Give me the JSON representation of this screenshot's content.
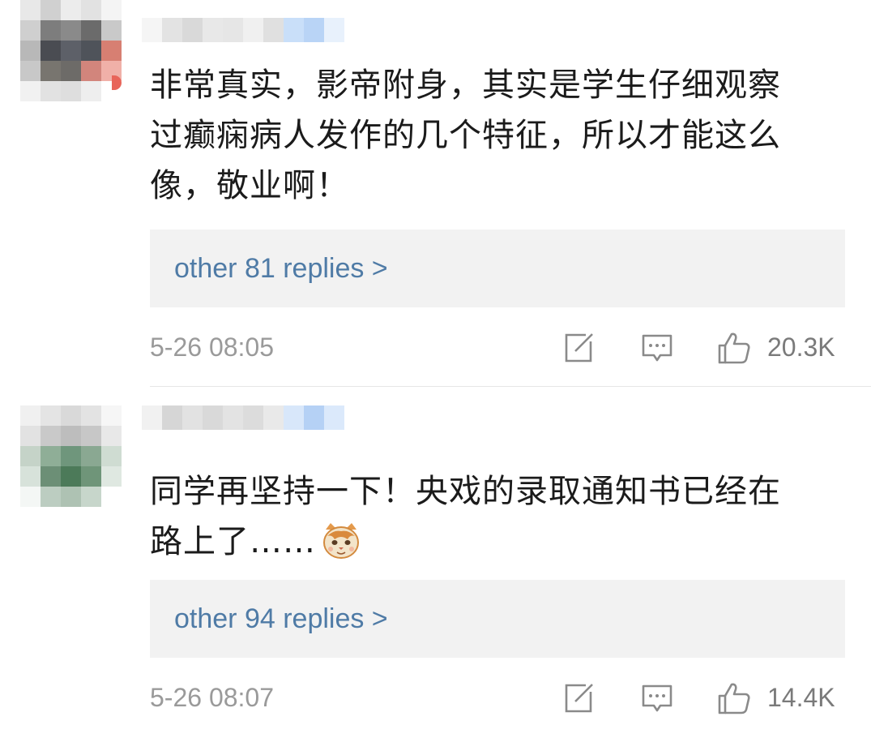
{
  "comments": [
    {
      "text_lines": [
        "非常真实，影帝附身，其实是学生仔细观察",
        "过癫痫病人发作的几个特征，所以才能这么",
        "像，敬业啊！"
      ],
      "replies_link": "other 81 replies >",
      "timestamp": "5-26 08:05",
      "like_count": "20.3K",
      "avatar_colors": [
        "#e8e8e8",
        "#d0d0d0",
        "#ececec",
        "#e2e2e2",
        "#f4f4f4",
        "#cfcfcf",
        "#7d7d7d",
        "#8a8a8a",
        "#6b6b6b",
        "#c9c9c9",
        "#b8b8b8",
        "#4a4c52",
        "#5d6068",
        "#4f535a",
        "#d77f72",
        "#c8c8c8",
        "#78756f",
        "#6d6b68",
        "#d2857c",
        "#f0b0a8",
        "#f1f1f1",
        "#e2e2e2",
        "#dedede",
        "#eeeeee",
        "#ffffff"
      ],
      "username_colors": [
        "#f5f5f5",
        "#e3e3e3",
        "#d9d9d9",
        "#e8e8e8",
        "#e6e6e6",
        "#f0f0f0",
        "#e0e0e0",
        "#c9dff9",
        "#b9d4f6",
        "#e8f1fc"
      ]
    },
    {
      "text_lines": [
        "同学再坚持一下！央戏的录取通知书已经在",
        "路上了……"
      ],
      "replies_link": "other 94 replies >",
      "timestamp": "5-26 08:07",
      "like_count": "14.4K",
      "avatar_colors": [
        "#f0f0f0",
        "#e4e4e4",
        "#d9d9d9",
        "#e3e3e3",
        "#f6f6f6",
        "#e2e2e2",
        "#c9c9c9",
        "#bdbdbd",
        "#c7c7c7",
        "#e8e8e8",
        "#c5d3c8",
        "#8fae97",
        "#6f967c",
        "#8aa892",
        "#cfdcd2",
        "#d7e2da",
        "#6c8f76",
        "#4c7a59",
        "#6f9579",
        "#dfe8e1",
        "#f4f7f5",
        "#bccdc1",
        "#aec2b3",
        "#c7d6cb",
        "#ffffff"
      ],
      "username_colors": [
        "#f1f1f1",
        "#d6d6d6",
        "#e2e2e2",
        "#d9d9d9",
        "#e3e3e3",
        "#dcdcdc",
        "#e9e9e9",
        "#d8e7fa",
        "#b5d1f5",
        "#dbe9fb"
      ]
    }
  ],
  "icons": {
    "share": "edit-share-icon",
    "reply": "comment-bubble-icon",
    "like": "thumbs-up-icon",
    "emoji": "cat-face-emoji-icon"
  },
  "colors": {
    "reply_link": "#4f7ba6",
    "reply_box": "#f2f2f2",
    "meta_text": "#9a9a9a"
  }
}
